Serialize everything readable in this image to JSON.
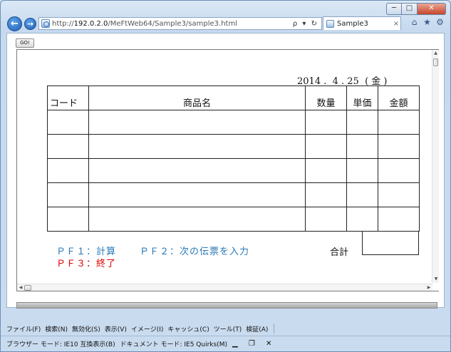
{
  "window": {
    "controls": {
      "minimize": "─",
      "maximize": "□",
      "close": "✕"
    }
  },
  "nav": {
    "back": "←",
    "forward": "→",
    "url_prefix": "http://",
    "url_host": "192.0.2.0",
    "url_path": "/MeFtWeb64/Sample3/sample3.html",
    "addr_tools": "ρ ▾ ↻"
  },
  "tab": {
    "label": "Sample3",
    "close": "×"
  },
  "right_tools": {
    "home": "⌂",
    "favorites": "★",
    "settings": "⚙"
  },
  "page": {
    "go_button": "GO!",
    "date": "2014 .  4 . 25  ( 金 )",
    "columns": [
      "コード",
      "商品名",
      "数量",
      "単価",
      "金額"
    ],
    "row_count": 5,
    "total_label": "合計",
    "pf1": "ＰＦ１：計算",
    "pf2": "ＰＦ２：次の伝票を入力",
    "pf3": "ＰＦ３：終了"
  },
  "scroll": {
    "up": "▲",
    "down": "▼",
    "left": "◀",
    "right": "▶"
  },
  "menubar": {
    "items": [
      "ファイル(F)",
      "検索(N)",
      "無効化(S)",
      "表示(V)",
      "イメージ(I)",
      "キャッシュ(C)",
      "ツール(T)",
      "検証(A)"
    ]
  },
  "statusbar": {
    "browser_mode": "ブラウザー モード: IE10 互換表示(B)",
    "document_mode": "ドキュメント モード: IE5 Quirks(M)",
    "icons": "▁ ❐ ✕"
  }
}
